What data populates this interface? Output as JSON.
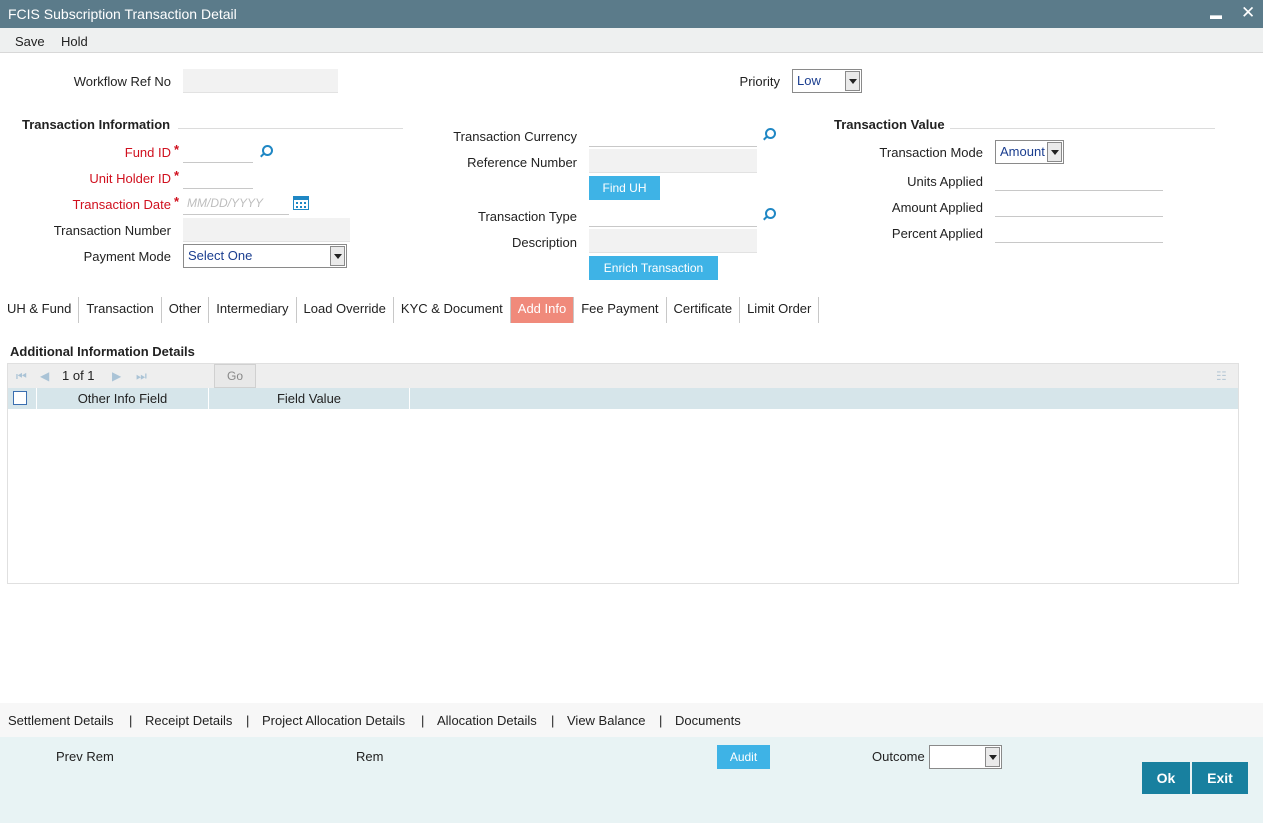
{
  "window": {
    "title": "FCIS Subscription Transaction Detail",
    "minimize_glyph": "▬",
    "close_glyph": "✕"
  },
  "menu": {
    "save": "Save",
    "hold": "Hold"
  },
  "header": {
    "workflow_ref_label": "Workflow Ref No",
    "workflow_ref_value": "",
    "priority_label": "Priority",
    "priority_value": "Low"
  },
  "transaction_info": {
    "title": "Transaction Information",
    "fund_id_label": "Fund ID",
    "unit_holder_label": "Unit Holder ID",
    "transaction_date_label": "Transaction Date",
    "transaction_date_placeholder": "MM/DD/YYYY",
    "transaction_number_label": "Transaction Number",
    "payment_mode_label": "Payment Mode",
    "payment_mode_value": "Select One",
    "required_mark": "*"
  },
  "middle": {
    "currency_label": "Transaction Currency",
    "reference_label": "Reference Number",
    "find_uh": "Find UH",
    "type_label": "Transaction Type",
    "description_label": "Description",
    "enrich": "Enrich Transaction"
  },
  "transaction_value": {
    "title": "Transaction Value",
    "mode_label": "Transaction Mode",
    "mode_value": "Amount",
    "units_label": "Units Applied",
    "amount_label": "Amount Applied",
    "percent_label": "Percent Applied"
  },
  "tabs": [
    {
      "label": "UH & Fund",
      "active": false
    },
    {
      "label": "Transaction",
      "active": false
    },
    {
      "label": "Other",
      "active": false
    },
    {
      "label": "Intermediary",
      "active": false
    },
    {
      "label": "Load Override",
      "active": false
    },
    {
      "label": "KYC & Document",
      "active": false
    },
    {
      "label": "Add Info",
      "active": true
    },
    {
      "label": "Fee Payment",
      "active": false
    },
    {
      "label": "Certificate",
      "active": false
    },
    {
      "label": "Limit Order",
      "active": false
    }
  ],
  "additional_info": {
    "title": "Additional Information Details",
    "pager_text": "1 of 1",
    "go": "Go",
    "columns": [
      "Other Info Field",
      "Field Value"
    ]
  },
  "footer_links": [
    "Settlement Details",
    "|",
    "Receipt Details",
    "|",
    "Project Allocation Details",
    "|",
    "Allocation Details",
    "|",
    "View Balance",
    "|",
    "Documents"
  ],
  "bottom": {
    "prev_rem": "Prev Rem",
    "rem": "Rem",
    "audit": "Audit",
    "outcome_label": "Outcome",
    "outcome_value": "",
    "ok": "Ok",
    "exit": "Exit"
  },
  "colors": {
    "titlebar": "#5b7b8a",
    "accent_blue": "#3eb3e6",
    "active_tab": "#f08a7b",
    "teal_button": "#18809f",
    "required": "#d0101e"
  }
}
